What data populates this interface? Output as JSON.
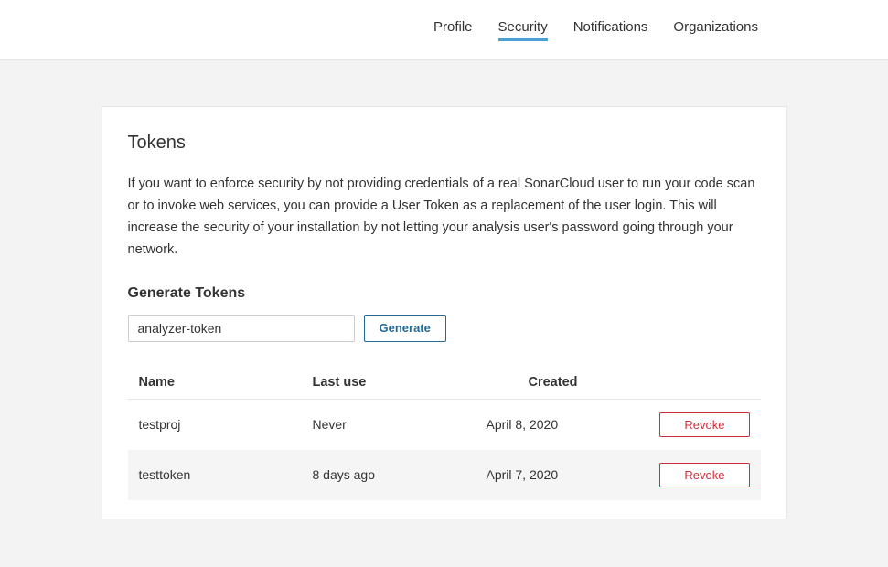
{
  "nav": {
    "items": [
      {
        "label": "Profile",
        "active": false
      },
      {
        "label": "Security",
        "active": true
      },
      {
        "label": "Notifications",
        "active": false
      },
      {
        "label": "Organizations",
        "active": false
      }
    ]
  },
  "tokens": {
    "title": "Tokens",
    "description": "If you want to enforce security by not providing credentials of a real SonarCloud user to run your code scan or to invoke web services, you can provide a User Token as a replacement of the user login. This will increase the security of your installation by not letting your analysis user's password going through your network.",
    "generate_title": "Generate Tokens",
    "name_input_value": "analyzer-token",
    "generate_button": "Generate",
    "columns": {
      "name": "Name",
      "last_use": "Last use",
      "created": "Created"
    },
    "revoke_button": "Revoke",
    "rows": [
      {
        "name": "testproj",
        "last_use": "Never",
        "created": "April 8, 2020"
      },
      {
        "name": "testtoken",
        "last_use": "8 days ago",
        "created": "April 7, 2020"
      }
    ]
  }
}
